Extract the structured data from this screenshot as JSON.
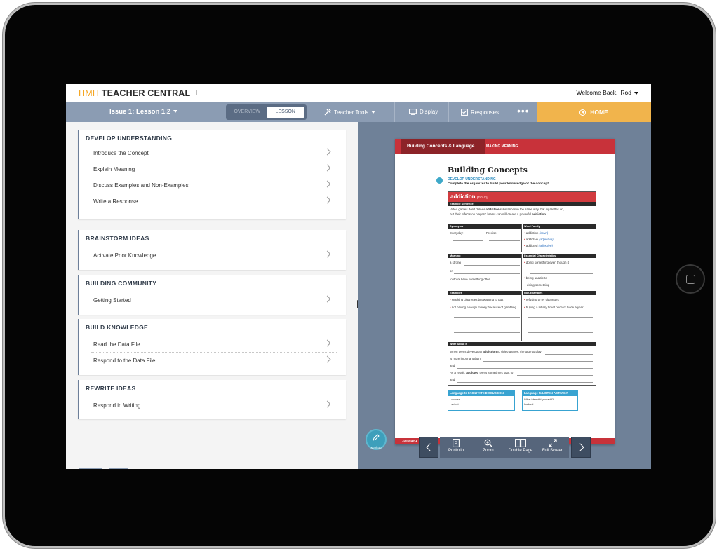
{
  "app": {
    "brand_prefix": "HMH",
    "brand_name": "TEACHER CENTRAL",
    "welcome": "Welcome Back,",
    "user": "Rod"
  },
  "nav": {
    "issue": "Issue 1: Lesson 1.2",
    "tabs": [
      "OVERVIEW",
      "LESSON"
    ],
    "active_tab": "LESSON",
    "teacher_tools": "Teacher Tools",
    "display": "Display",
    "responses": "Responses",
    "more": "•••",
    "home": "HOME"
  },
  "sections": [
    {
      "title": "DEVELOP UNDERSTANDING",
      "items": [
        "Introduce the Concept",
        "Explain Meaning",
        "Discuss Examples and Non-Examples",
        "Write a Response"
      ]
    },
    {
      "title": "BRAINSTORM IDEAS",
      "items": [
        "Activate Prior Knowledge"
      ]
    },
    {
      "title": "BUILDING COMMUNITY",
      "items": [
        "Getting Started"
      ]
    },
    {
      "title": "BUILD KNOWLEDGE",
      "items": [
        "Read the Data File",
        "Respond to the Data File"
      ]
    },
    {
      "title": "REWRITE IDEAS",
      "items": [
        "Respond in Writing"
      ]
    }
  ],
  "document": {
    "band": "Building Concepts & Language",
    "band_sub": "MAKING MEANING",
    "title": "Building Concepts",
    "sub": "DEVELOP UNDERSTANDING",
    "instructions": "Complete the organizer to build your knowledge of the concept.",
    "word": "addiction",
    "pos": "(noun)",
    "example_head": "Example Sentence",
    "example_1a": "Video games don't deliver ",
    "example_1b": "addictive",
    "example_1c": " substances in the same way that cigarettes do,",
    "example_2a": "but their effects on players' brains can still create a powerful ",
    "example_2b": "addiction",
    "example_2c": ".",
    "synonyms_head": "Synonyms",
    "everyday": "Everyday:",
    "precise": "Precise:",
    "family_head": "Word Family",
    "family": [
      {
        "word": "addiction",
        "pos": "(noun)"
      },
      {
        "word": "addictive",
        "pos": "(adjective)"
      },
      {
        "word": "addicted",
        "pos": "(adjective)"
      }
    ],
    "meaning_head": "Meaning",
    "meaning_1": "a strong",
    "meaning_2": "or",
    "meaning_3": "to do or have something often",
    "chars_head": "Essential Characteristics",
    "chars_1": "doing something even though it",
    "chars_2": "being unable to",
    "chars_3": "doing something",
    "examples_head": "Examples",
    "examples_1": "smoking cigarettes but wanting to quit",
    "examples_2": "not having enough money because of gambling",
    "nonex_head": "Non-Examples",
    "nonex_1": "refusing to try cigarettes",
    "nonex_2": "buying a lottery ticket once or twice a year",
    "write_head": "Write About It",
    "write_1a": "When teens develop an ",
    "write_1b": "addiction",
    "write_1c": " to video games, the urge to play",
    "write_2": "is more important than",
    "write_3": "and",
    "write_4a": "As a result, ",
    "write_4b": "addicted",
    "write_4c": " teens sometimes start to",
    "write_5": "and",
    "callout_1_head": "Language to FACILITATE DISCUSSION",
    "callout_1_a": "I choose",
    "callout_1_b": "I select",
    "callout_2_head": "Language to LISTEN ACTIVELY",
    "callout_2_a": "What idea did you add?",
    "callout_2_b": "I added",
    "footer": "10   Issue 1"
  },
  "viewer": {
    "markup": "Markup",
    "tools": [
      "Portfolio",
      "Zoom",
      "Double Page",
      "Full Screen"
    ]
  },
  "colors": {
    "nav_bg": "#8b9cb3",
    "home_bg": "#f1b44c",
    "accent_red": "#c8323a",
    "viewer_bg": "#6f8198"
  }
}
